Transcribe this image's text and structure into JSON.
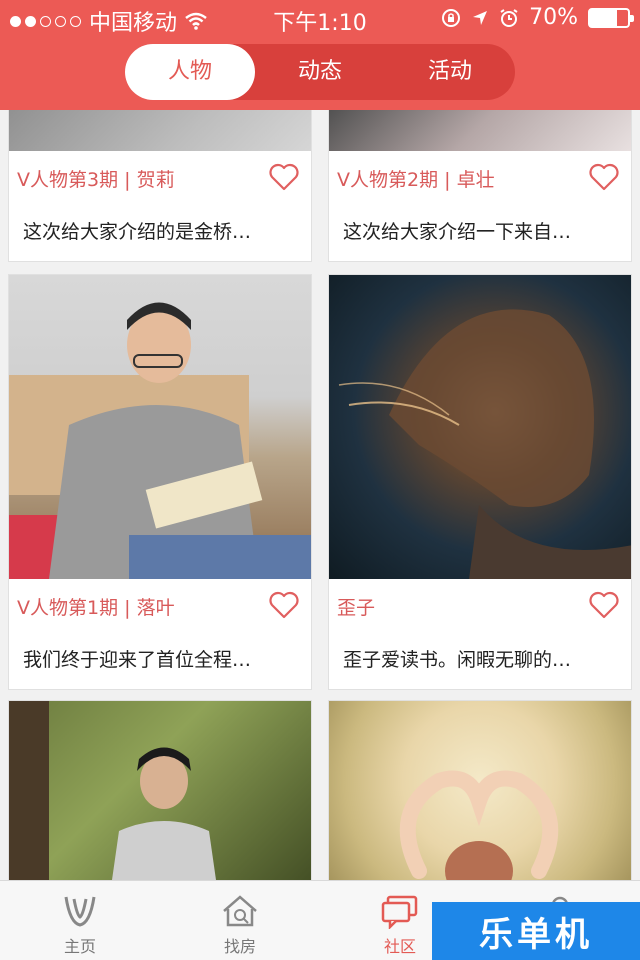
{
  "status": {
    "carrier": "中国移动",
    "time": "下午1:10",
    "battery": "70%",
    "battery_level": 0.7
  },
  "tabs": [
    {
      "label": "人物",
      "active": true
    },
    {
      "label": "动态",
      "active": false
    },
    {
      "label": "活动",
      "active": false
    }
  ],
  "cards": [
    {
      "title": "V人物第3期 | 贺莉",
      "desc": "这次给大家介绍的是金桥…"
    },
    {
      "title": "V人物第2期 | 卓壮",
      "desc": "这次给大家介绍一下来自…"
    },
    {
      "title": "V人物第1期 | 落叶",
      "desc": "我们终于迎来了首位全程…"
    },
    {
      "title": "歪子",
      "desc": "歪子爱读书。闲暇无聊的…"
    }
  ],
  "bottom_nav": [
    {
      "label": "主页",
      "icon": "v-logo-icon"
    },
    {
      "label": "找房",
      "icon": "house-search-icon"
    },
    {
      "label": "社区",
      "icon": "chat-bubbles-icon",
      "active": true
    },
    {
      "label": "",
      "icon": "profile-icon"
    }
  ],
  "watermark": "乐单机",
  "colors": {
    "accent": "#ec5a55",
    "title_red": "#d85a5a"
  }
}
